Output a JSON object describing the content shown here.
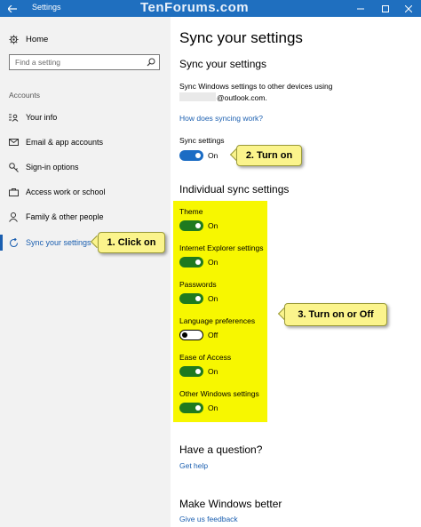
{
  "titlebar": {
    "back_icon": "back-arrow-icon",
    "title": "Settings",
    "watermark": "TenForums.com",
    "minimize_glyph": "—",
    "maximize_glyph": "☐",
    "close_glyph": "✕",
    "bg_color": "#1f6fbf"
  },
  "sidebar": {
    "home_label": "Home",
    "search_placeholder": "Find a setting",
    "section_label": "Accounts",
    "items": [
      {
        "label": "Your info",
        "icon": "person-card-icon"
      },
      {
        "label": "Email & app accounts",
        "icon": "mail-icon"
      },
      {
        "label": "Sign-in options",
        "icon": "key-icon"
      },
      {
        "label": "Access work or school",
        "icon": "briefcase-icon"
      },
      {
        "label": "Family & other people",
        "icon": "person-icon"
      },
      {
        "label": "Sync your settings",
        "icon": "sync-icon",
        "active": true
      }
    ],
    "accent_color": "#1b5fb0"
  },
  "main": {
    "page_title": "Sync your settings",
    "section_title": "Sync your settings",
    "description_line1": "Sync Windows settings to other devices using",
    "description_line2": "@outlook.com.",
    "how_link": "How does syncing work?",
    "sync_settings_label": "Sync settings",
    "sync_settings_state": "On",
    "individual_title": "Individual sync settings",
    "individual": [
      {
        "label": "Theme",
        "state": "On",
        "on": true
      },
      {
        "label": "Internet Explorer settings",
        "state": "On",
        "on": true
      },
      {
        "label": "Passwords",
        "state": "On",
        "on": true
      },
      {
        "label": "Language preferences",
        "state": "Off",
        "on": false
      },
      {
        "label": "Ease of Access",
        "state": "On",
        "on": true
      },
      {
        "label": "Other Windows settings",
        "state": "On",
        "on": true
      }
    ],
    "question_title": "Have a question?",
    "help_link": "Get help",
    "better_title": "Make Windows better",
    "feedback_link": "Give us feedback"
  },
  "callouts": {
    "click_on": "1. Click on",
    "turn_on": "2. Turn on",
    "turn_on_off": "3. Turn on or Off",
    "highlight_color": "#f7f700",
    "callout_color": "#fbf48c"
  }
}
